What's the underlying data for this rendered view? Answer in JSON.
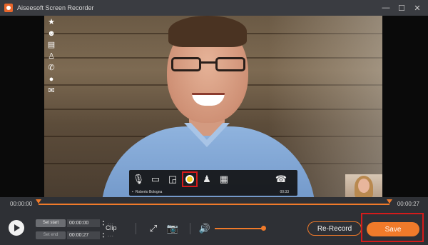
{
  "window": {
    "title": "Aiseesoft Screen Recorder",
    "controls": {
      "minimize": "—",
      "maximize": "☐",
      "close": "✕"
    }
  },
  "video": {
    "side_tools": [
      "star-icon",
      "group-icon",
      "contact-card-icon",
      "user-add-icon",
      "call-icon",
      "chat-icon",
      "mail-icon"
    ],
    "call_toolbar": {
      "icons": [
        "mic-off-icon",
        "video-off-icon",
        "share-screen-icon",
        "record-icon",
        "participants-icon",
        "keypad-icon",
        "hang-up-icon"
      ],
      "participant": "Roberto Bologna",
      "time": "00:33"
    }
  },
  "timeline": {
    "start": "00:00:00",
    "end": "00:00:27"
  },
  "controls": {
    "set_start_label": "Set start",
    "set_end_label": "Set end",
    "start_time": "00:00:00",
    "end_time": "00:00:27",
    "dots": "...",
    "clip_label": "Clip",
    "rerecord_label": "Re-Record",
    "save_label": "Save",
    "volume_level": 0.95
  },
  "colors": {
    "accent": "#f07a2a",
    "highlight": "#d51b1b"
  }
}
